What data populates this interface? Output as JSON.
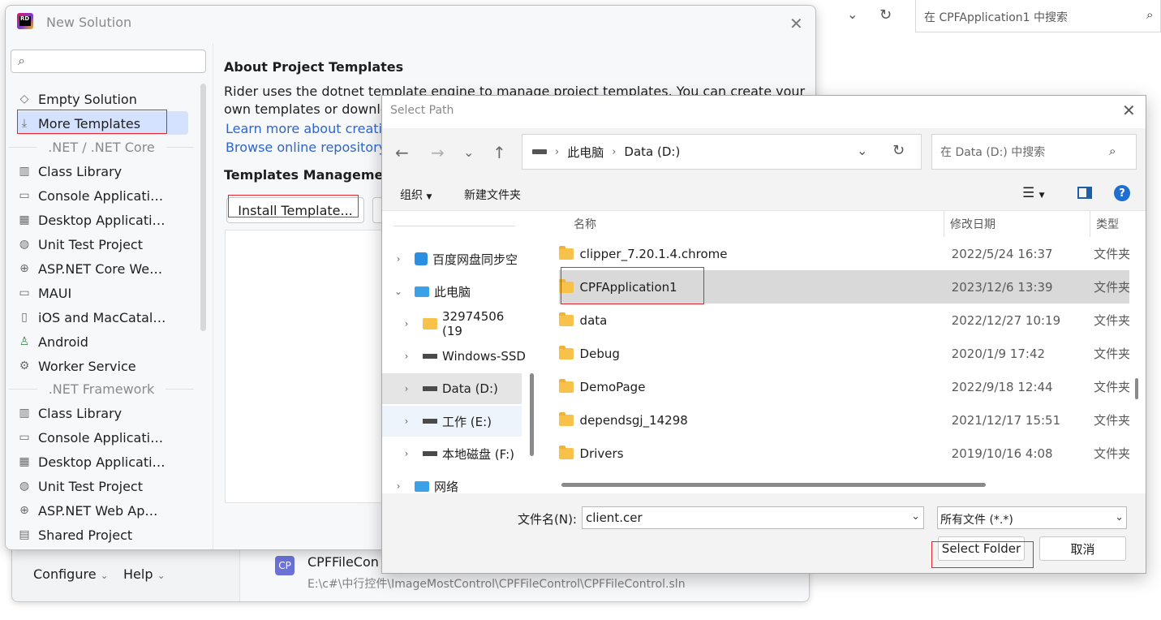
{
  "background": {
    "search_placeholder": "在 CPFApplication1 中搜索",
    "welcome": {
      "configure_label": "Configure",
      "help_label": "Help",
      "recent_icon_text": "CP",
      "recent_name": "CPFFileCon",
      "recent_path": "E:\\c#\\中行控件\\ImageMostControl\\CPFFileControl\\CPFFileControl.sln"
    }
  },
  "new_solution": {
    "title": "New Solution",
    "logo_text": "RD",
    "sidebar": {
      "items": [
        {
          "label": "Empty Solution",
          "icon": "empty-solution-icon"
        },
        {
          "label": "More Templates",
          "icon": "download-icon",
          "selected": true
        }
      ],
      "groups": [
        {
          "title": ".NET / .NET Core",
          "items": [
            {
              "label": "Class Library",
              "icon": "library-icon"
            },
            {
              "label": "Console Applicati…",
              "icon": "console-icon"
            },
            {
              "label": "Desktop Applicati…",
              "icon": "window-icon"
            },
            {
              "label": "Unit Test Project",
              "icon": "test-icon"
            },
            {
              "label": "ASP.NET Core We…",
              "icon": "globe-icon"
            },
            {
              "label": "MAUI",
              "icon": "monitor-icon"
            },
            {
              "label": "iOS and MacCatal…",
              "icon": "device-icon"
            },
            {
              "label": "Android",
              "icon": "android-icon"
            },
            {
              "label": "Worker Service",
              "icon": "gear-icon"
            }
          ]
        },
        {
          "title": ".NET Framework",
          "items": [
            {
              "label": "Class Library",
              "icon": "library-icon"
            },
            {
              "label": "Console Applicati…",
              "icon": "console-icon"
            },
            {
              "label": "Desktop Applicati…",
              "icon": "window-icon"
            },
            {
              "label": "Unit Test Project",
              "icon": "test-icon"
            },
            {
              "label": "ASP.NET Web Ap…",
              "icon": "globe-icon"
            },
            {
              "label": "Shared Project",
              "icon": "shared-icon"
            }
          ]
        }
      ]
    },
    "main": {
      "about_heading": "About Project Templates",
      "about_line1": "Rider uses the dotnet template engine to manage project templates. You can create your",
      "about_line2": "own templates or downlo",
      "learn_link": "Learn more about creatin",
      "browse_link": "Browse online repository",
      "mgmt_heading": "Templates Managemen",
      "install_button": "Install Template..."
    }
  },
  "select_path": {
    "title": "Select Path",
    "breadcrumb": [
      "此电脑",
      "Data (D:)"
    ],
    "search_placeholder": "在 Data (D:) 中搜索",
    "toolbar": {
      "organize": "组织",
      "new_folder": "新建文件夹"
    },
    "tree": [
      {
        "label": "百度网盘同步空",
        "expander": "›"
      },
      {
        "label": "此电脑",
        "expander": "⌄"
      },
      {
        "label": "32974506 (19",
        "expander": "›"
      },
      {
        "label": "Windows-SSD",
        "expander": "›"
      },
      {
        "label": "Data (D:)",
        "expander": "›",
        "selected": true
      },
      {
        "label": "工作 (E:)",
        "expander": "›"
      },
      {
        "label": "本地磁盘 (F:)",
        "expander": "›"
      },
      {
        "label": "网络",
        "expander": "›"
      }
    ],
    "columns": {
      "name": "名称",
      "date": "修改日期",
      "type": "类型"
    },
    "files": [
      {
        "name": "clipper_7.20.1.4.chrome",
        "date": "2022/5/24 16:37",
        "type": "文件夹"
      },
      {
        "name": "CPFApplication1",
        "date": "2023/12/6 13:39",
        "type": "文件夹",
        "selected": true
      },
      {
        "name": "data",
        "date": "2022/12/27 10:19",
        "type": "文件夹"
      },
      {
        "name": "Debug",
        "date": "2020/1/9 17:42",
        "type": "文件夹"
      },
      {
        "name": "DemoPage",
        "date": "2022/9/18 12:44",
        "type": "文件夹"
      },
      {
        "name": "dependsgj_14298",
        "date": "2021/12/17 15:51",
        "type": "文件夹"
      },
      {
        "name": "Drivers",
        "date": "2019/10/16 4:08",
        "type": "文件夹"
      }
    ],
    "filename_label": "文件名(N):",
    "filename_value": "client.cer",
    "filetype_value": "所有文件 (*.*)",
    "select_button": "Select Folder",
    "cancel_button": "取消"
  }
}
